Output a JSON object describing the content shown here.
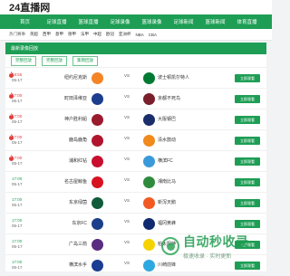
{
  "site": {
    "logo": "24直播网"
  },
  "nav": [
    "首页",
    "足球直播",
    "篮球直播",
    "足球录像",
    "篮球录像",
    "足球新闻",
    "篮球新闻",
    "体育直播"
  ],
  "subnav": [
    "热门赛事",
    "英超",
    "西甲",
    "意甲",
    "德甲",
    "法甲",
    "中超",
    "欧冠",
    "亚洲杯",
    "NBA",
    "CBA"
  ],
  "panel": {
    "heading": "最新录像回放"
  },
  "tabs": [
    "完整回放",
    "完整回放",
    "集锦回放"
  ],
  "matches": [
    {
      "time": "18:55",
      "date": "05-17",
      "status": "live",
      "home": "纽约尼克斯",
      "away": "波士顿凯尔特人",
      "vs": "VS",
      "home_color": "#f58426",
      "away_color": "#007a33",
      "watch": "立即观看"
    },
    {
      "time": "17:00",
      "date": "05-17",
      "status": "live",
      "home": "町田泽维亚",
      "away": "京都不死鸟",
      "vs": "VS",
      "home_color": "#1d3d8f",
      "away_color": "#7a1f2b",
      "watch": "立即观看"
    },
    {
      "time": "17:00",
      "date": "05-17",
      "status": "live",
      "home": "神户胜利船",
      "away": "大阪钢巴",
      "vs": "VS",
      "home_color": "#9b1b2e",
      "away_color": "#1a2e6c",
      "watch": "立即观看"
    },
    {
      "time": "17:00",
      "date": "05-17",
      "status": "live",
      "home": "鹿岛鹿角",
      "away": "清水鼓动",
      "vs": "VS",
      "home_color": "#b0152d",
      "away_color": "#f08a1c",
      "watch": "立即观看"
    },
    {
      "time": "17:00",
      "date": "05-17",
      "status": "live",
      "home": "浦和红钻",
      "away": "横滨FC",
      "vs": "VS",
      "home_color": "#c8102e",
      "away_color": "#3a9ad9",
      "watch": "立即观看"
    },
    {
      "time": "17:00",
      "date": "05-17",
      "status": "fin",
      "home": "名古屋鲸鱼",
      "away": "湘南比马",
      "vs": "VS",
      "home_color": "#d7131f",
      "away_color": "#2e8b3c",
      "watch": "立即观看"
    },
    {
      "time": "17:00",
      "date": "05-17",
      "status": "fin",
      "home": "东京绿茵",
      "away": "新泻天鹅",
      "vs": "VS",
      "home_color": "#0f5b3a",
      "away_color": "#f15a22",
      "watch": "立即观看"
    },
    {
      "time": "17:00",
      "date": "05-17",
      "status": "fin",
      "home": "东京FC",
      "away": "福冈黄蜂",
      "vs": "VS",
      "home_color": "#1b3f8b",
      "away_color": "#0f2a6e",
      "watch": "立即观看"
    },
    {
      "time": "17:00",
      "date": "05-17",
      "status": "fin",
      "home": "广岛三箭",
      "away": "柏太阳神",
      "vs": "VS",
      "home_color": "#5a2d82",
      "away_color": "#f5d300",
      "watch": "立即观看"
    },
    {
      "time": "17:00",
      "date": "05-17",
      "status": "fin",
      "home": "横滨水手",
      "away": "川崎前锋",
      "vs": "VS",
      "home_color": "#1c3d94",
      "away_color": "#2ea8e0",
      "watch": "立即观看"
    }
  ],
  "watermark": {
    "title": "自动秒收录",
    "subtitle": "极速收录 · 实时更新"
  }
}
